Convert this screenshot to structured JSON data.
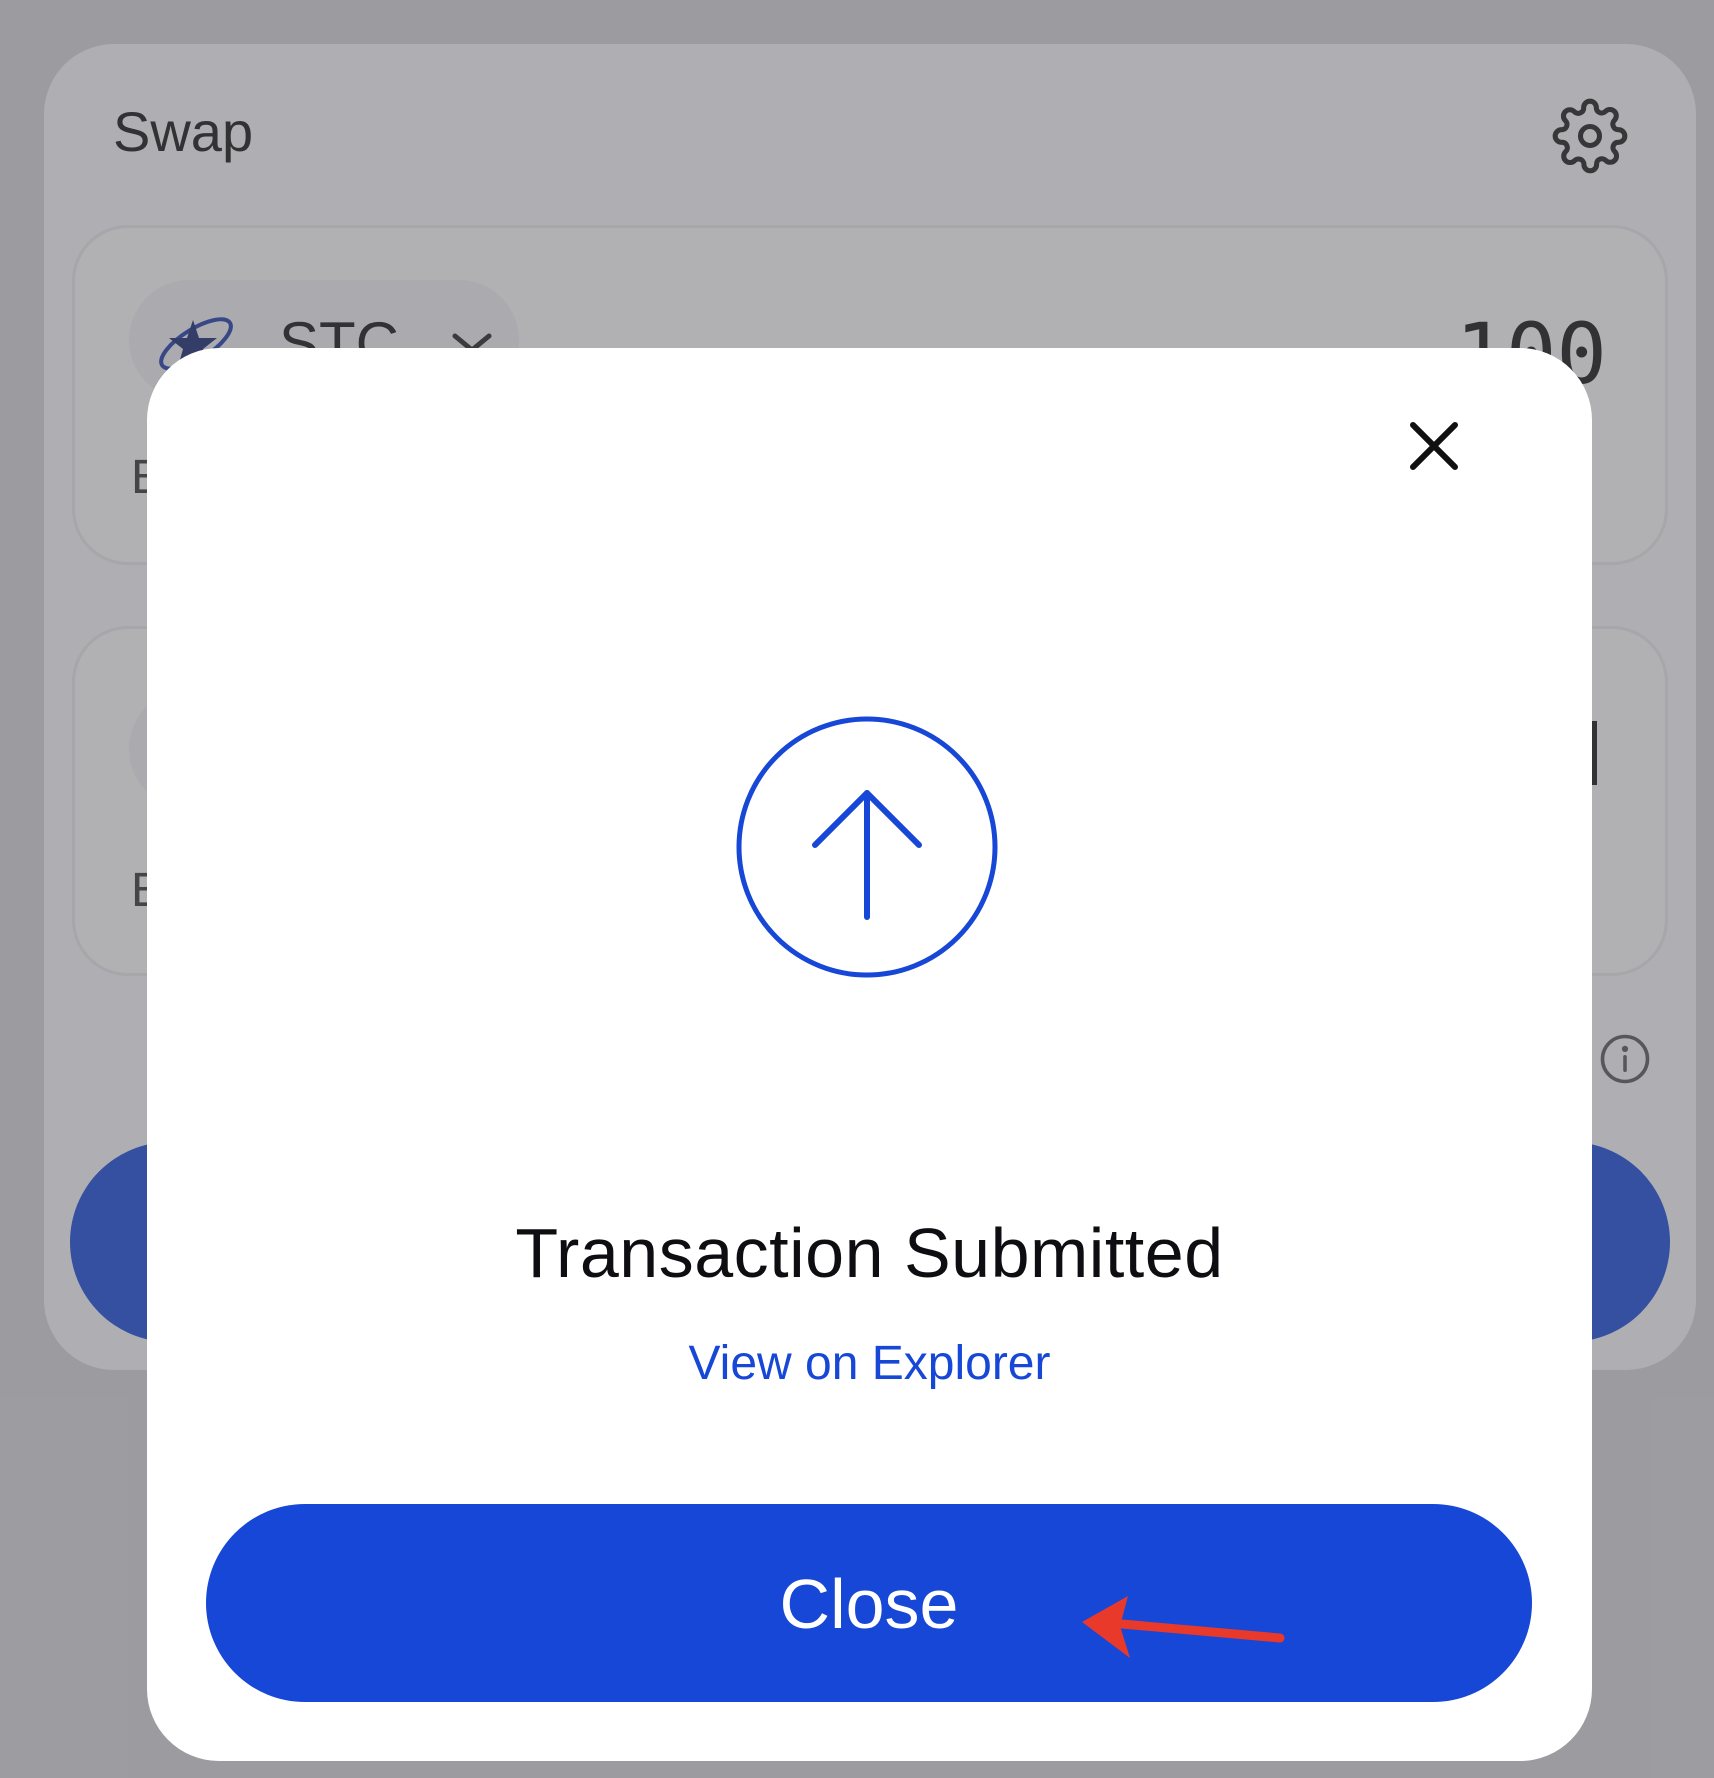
{
  "swap": {
    "title": "Swap",
    "from_token": {
      "symbol": "STC",
      "amount": "100",
      "balance_label": "B"
    },
    "to_token": {
      "balance_label": "B"
    }
  },
  "modal": {
    "title": "Transaction Submitted",
    "explorer_link": "View on Explorer",
    "close_label": "Close"
  },
  "colors": {
    "accent": "#1747d6",
    "annotation": "#e8392a"
  },
  "icons": {
    "settings": "gear-icon",
    "modal_close": "close-icon",
    "status": "arrow-up-circle-icon",
    "info": "info-icon",
    "token_dropdown": "chevron-down-icon"
  }
}
